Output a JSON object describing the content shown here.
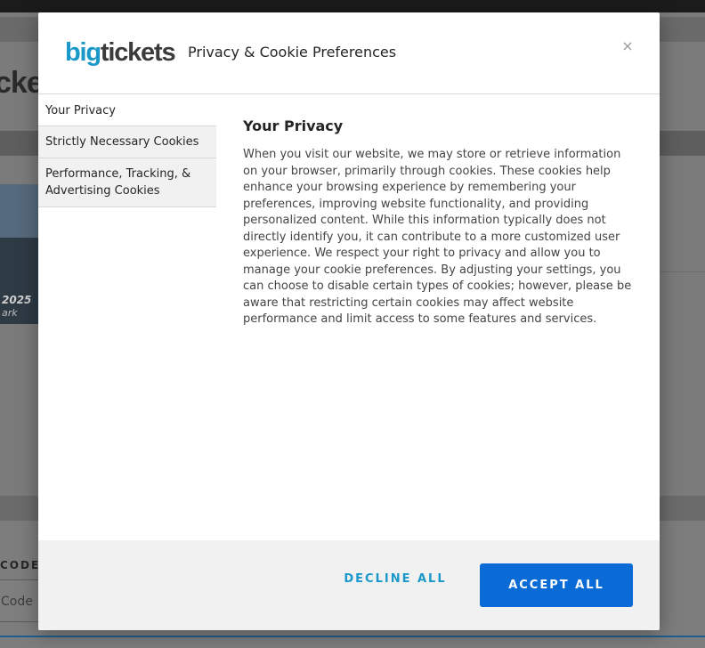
{
  "background": {
    "title_fragment": "cke",
    "card": {
      "date_fragment": "2025",
      "venue_fragment": "ark"
    },
    "code_label_fragment": "CODE",
    "code_input_fragment": "Code"
  },
  "modal": {
    "logo": {
      "part1": "big",
      "part2": "tickets"
    },
    "title": "Privacy & Cookie Preferences",
    "close_label": "×",
    "tabs": [
      {
        "label": "Your Privacy"
      },
      {
        "label": "Strictly Necessary Cookies"
      },
      {
        "label": "Performance, Tracking, & Advertising Cookies"
      }
    ],
    "content": {
      "heading": "Your Privacy",
      "body": "When you visit our website, we may store or retrieve information on your browser, primarily through cookies. These cookies help enhance your browsing experience by remembering your preferences, improving website functionality, and providing personalized content. While this information typically does not directly identify you, it can contribute to a more customized user experience. We respect your right to privacy and allow you to manage your cookie preferences. By adjusting your settings, you can choose to disable certain types of cookies; however, please be aware that restricting certain cookies may affect website performance and limit access to some features and services."
    },
    "footer": {
      "decline_label": "DECLINE ALL",
      "accept_label": "ACCEPT ALL"
    }
  },
  "colors": {
    "brand_blue": "#1a98c9",
    "accept_blue": "#0a6ad6",
    "overlay": "#7b7b7b"
  }
}
